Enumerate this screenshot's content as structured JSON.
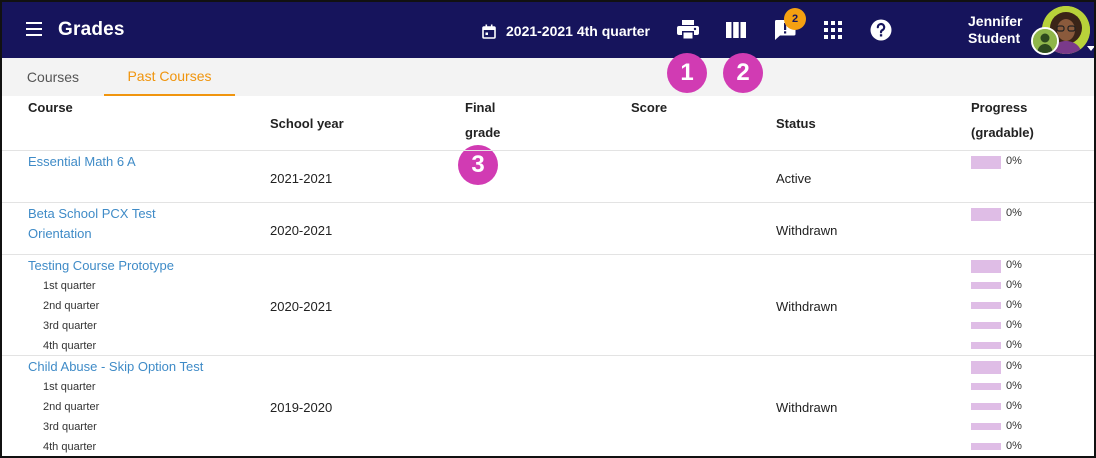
{
  "header": {
    "title": "Grades",
    "term": "2021-2021 4th quarter",
    "notification_count": "2",
    "user_first": "Jennifer",
    "user_last": "Student"
  },
  "tabs": [
    "Courses",
    "Past Courses"
  ],
  "active_tab": "Past Courses",
  "callouts": [
    "1",
    "2",
    "3"
  ],
  "table": {
    "headers": {
      "course": "Course",
      "school_year": "School year",
      "final_grade_1": "Final",
      "final_grade_2": "grade",
      "score": "Score",
      "status": "Status",
      "progress_1": "Progress",
      "progress_2": "(gradable)"
    },
    "rows": [
      {
        "name": "Essential Math 6 A",
        "school_year": "2021-2021",
        "status": "Active",
        "progress": "0%",
        "subterms": []
      },
      {
        "name_line1": "Beta School PCX Test",
        "name_line2": "Orientation",
        "school_year": "2020-2021",
        "status": "Withdrawn",
        "progress": "0%",
        "subterms": []
      },
      {
        "name": "Testing Course Prototype",
        "school_year": "2020-2021",
        "status": "Withdrawn",
        "progress": "0%",
        "subterms": [
          {
            "label": "1st quarter",
            "progress": "0%"
          },
          {
            "label": "2nd quarter",
            "progress": "0%"
          },
          {
            "label": "3rd quarter",
            "progress": "0%"
          },
          {
            "label": "4th quarter",
            "progress": "0%"
          }
        ]
      },
      {
        "name": "Child Abuse - Skip Option Test",
        "school_year": "2019-2020",
        "status": "Withdrawn",
        "progress": "0%",
        "subterms": [
          {
            "label": "1st quarter",
            "progress": "0%"
          },
          {
            "label": "2nd quarter",
            "progress": "0%"
          },
          {
            "label": "3rd quarter",
            "progress": "0%"
          },
          {
            "label": "4th quarter",
            "progress": "0%"
          }
        ]
      }
    ]
  },
  "colors": {
    "topbar": "#16145c",
    "accent": "#f0950e",
    "link": "#3f8bc7",
    "callout": "#d13bb3",
    "progress_bar": "#dfbde6"
  }
}
